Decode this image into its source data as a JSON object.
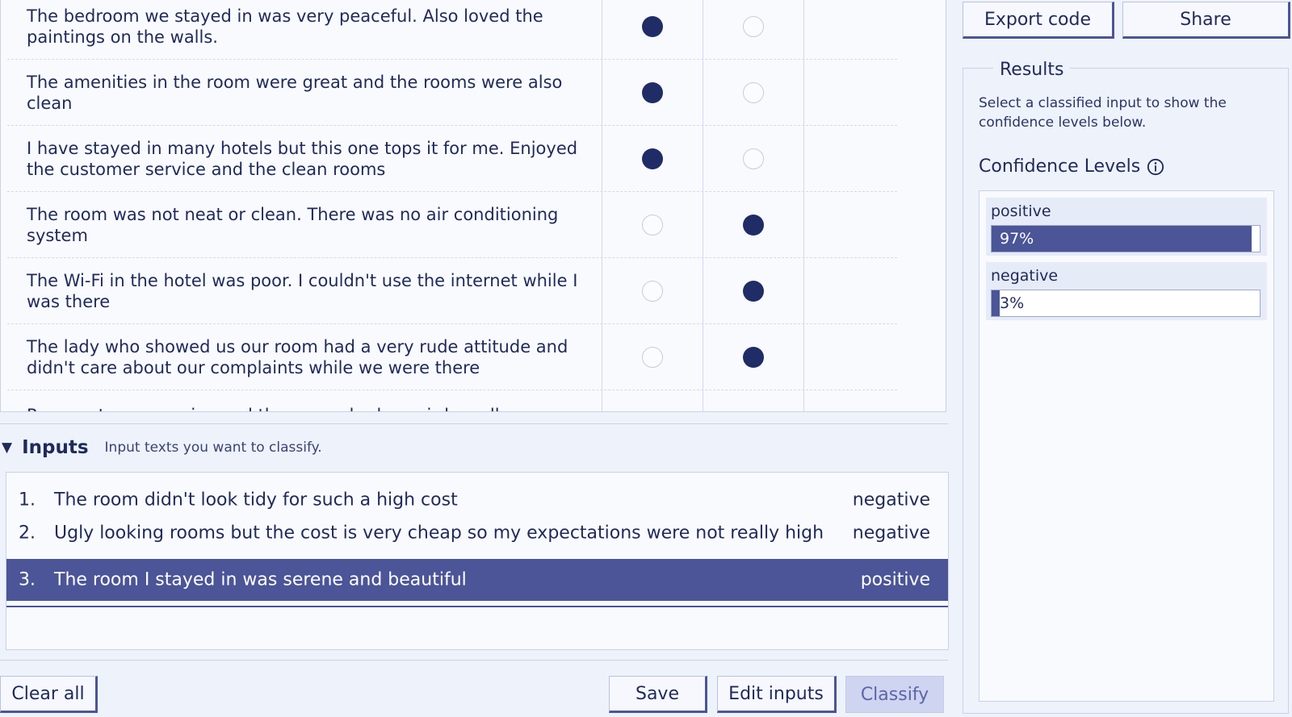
{
  "examples": {
    "rows": [
      {
        "text": "The bedroom we stayed in was very peaceful. Also loved the paintings on the walls.",
        "positive": true
      },
      {
        "text": "The amenities in the room were great and the rooms were also clean",
        "positive": true
      },
      {
        "text": "I have stayed in many hotels but this one tops it for me. Enjoyed the customer service and the clean rooms",
        "positive": true
      },
      {
        "text": "The room was not neat or clean. There was no air conditioning system",
        "positive": false
      },
      {
        "text": "The Wi-Fi in the hotel was poor. I couldn't use the internet while I was there",
        "positive": false
      },
      {
        "text": "The lady who showed us our room had a very rude attitude and didn't care about our complaints while we were there",
        "positive": false
      },
      {
        "text": "Poor customer service and the rooms had a weird smell even",
        "positive": false
      }
    ]
  },
  "inputs": {
    "title": "Inputs",
    "description": "Input texts you want to classify.",
    "items": [
      {
        "num": "1.",
        "text": "The room didn't look tidy for such a high cost",
        "label": "negative"
      },
      {
        "num": "2.",
        "text": "Ugly looking rooms but the cost  is very cheap so my expectations were not really high",
        "label": "negative"
      },
      {
        "num": "3.",
        "text": "The room I stayed in was serene and beautiful",
        "label": "positive"
      }
    ]
  },
  "buttons": {
    "clear_all": "Clear all",
    "save": "Save",
    "edit_inputs": "Edit inputs",
    "classify": "Classify",
    "export_code": "Export code",
    "share": "Share"
  },
  "results": {
    "title": "Results",
    "description": "Select a classified input to show the confidence levels below.",
    "confidence_title": "Confidence Levels",
    "levels": [
      {
        "label": "positive",
        "value": 0.97,
        "text": "97%"
      },
      {
        "label": "negative",
        "value": 0.03,
        "text": "3%"
      }
    ]
  },
  "colors": {
    "accent": "#4b5597",
    "dark_fill": "#1f2c66",
    "background": "#eef2fb"
  }
}
